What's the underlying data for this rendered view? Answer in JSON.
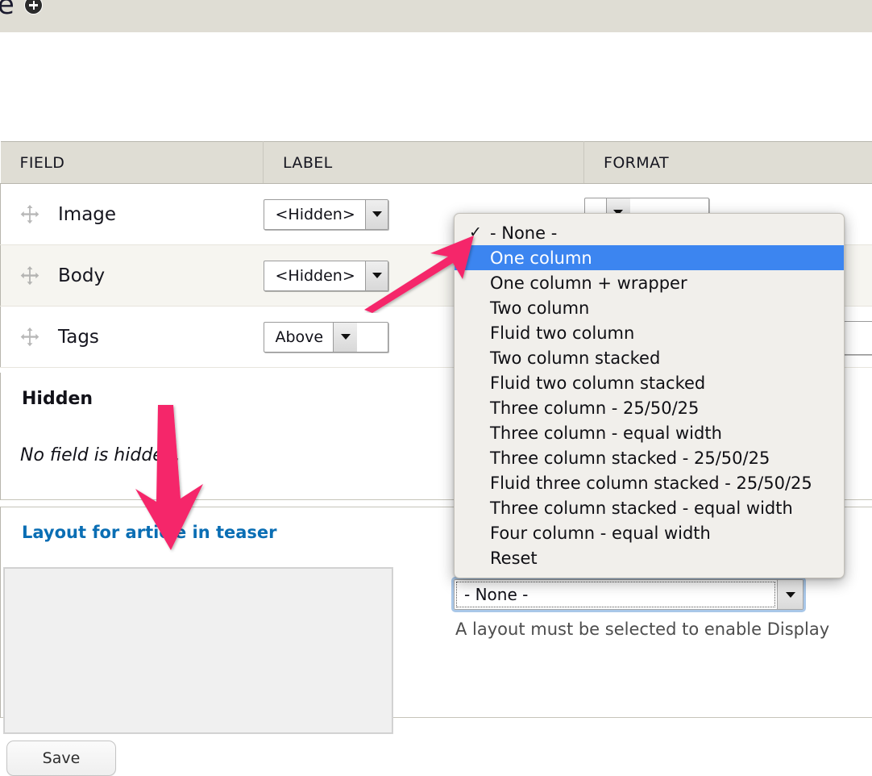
{
  "header": {
    "page_title": "ticle",
    "config_icon": "gear-plus-icon"
  },
  "field_table": {
    "columns": [
      "FIELD",
      "LABEL",
      "FORMAT"
    ],
    "rows": [
      {
        "field": "Image",
        "label": "<Hidden>",
        "format": ""
      },
      {
        "field": "Body",
        "label": "<Hidden>",
        "format": ""
      },
      {
        "field": "Tags",
        "label": "Above",
        "format": ""
      }
    ],
    "drag_icon": "move-cross-icon"
  },
  "hidden_section": {
    "heading": "Hidden",
    "empty_text": "No field is hidden."
  },
  "layout_section": {
    "legend": "Layout for article in teaser",
    "select_value": "- None -",
    "help_text": "A layout must be selected to enable Display"
  },
  "layout_popup": {
    "selected_value": "One column",
    "checked_value": "- None -",
    "check_glyph": "✓",
    "highlight_color": "#3c85f0",
    "items": [
      "- None -",
      "One column",
      "One column + wrapper",
      "Two column",
      "Fluid two column",
      "Two column stacked",
      "Fluid two column stacked",
      "Three column - 25/50/25",
      "Three column - equal width",
      "Three column stacked - 25/50/25",
      "Fluid three column stacked - 25/50/25",
      "Three column stacked - equal width",
      "Four column - equal width",
      "Reset"
    ]
  },
  "footer": {
    "save_label": "Save"
  },
  "annotations": {
    "arrow_color": "#f5276a",
    "arrow_up_right_target": "One column",
    "arrow_down_target": "Layout for article in teaser"
  }
}
